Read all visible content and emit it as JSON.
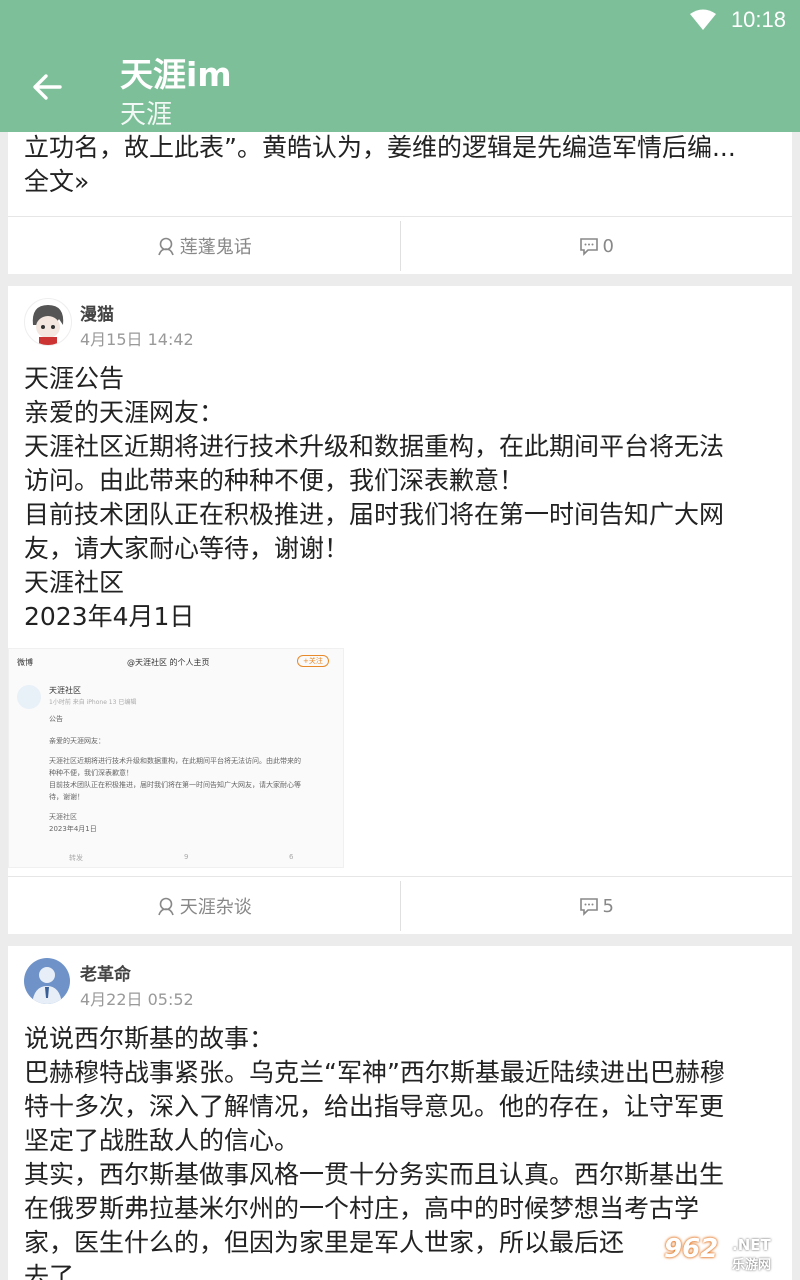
{
  "status_bar": {
    "time": "10:18"
  },
  "app_bar": {
    "title": "天涯im",
    "subtitle": "天涯"
  },
  "card1": {
    "text_lines": [
      "立功名，故上此表”。黄皓认为，姜维的逻辑是先编造军情后编...",
      "全文»"
    ],
    "board": "莲蓬鬼话",
    "comments": "0"
  },
  "card2": {
    "author": "漫猫",
    "time": "4月15日 14:42",
    "text_lines": [
      "天涯公告",
      "亲爱的天涯网友：",
      "天涯社区近期将进行技术升级和数据重构，在此期间平台将无法",
      "访问。由此带来的种种不便，我们深表歉意！",
      "目前技术团队正在积极推进，届时我们将在第一时间告知广大网",
      "友，请大家耐心等待，谢谢！",
      "天涯社区",
      "2023年4月1日"
    ],
    "image": {
      "back": "微博",
      "header": "@天涯社区 的个人主页",
      "follow": "+关注",
      "account": "天涯社区",
      "meta": "1小时前 来自 iPhone 13 已编辑",
      "lines": [
        "公告",
        "亲爱的天涯网友：",
        "天涯社区近期将进行技术升级和数据重构，在此期间平台将无法访问。由此带来的",
        "种种不便，我们深表歉意！",
        "目前技术团队正在积极推进，届时我们将在第一时间告知广大网友，请大家耐心等",
        "待，谢谢！",
        "天涯社区",
        "2023年4月1日"
      ],
      "repost": "转发",
      "comment": "9",
      "like": "6"
    },
    "board": "天涯杂谈",
    "comments": "5"
  },
  "card3": {
    "author": "老革命",
    "time": "4月22日 05:52",
    "text_lines": [
      "说说西尔斯基的故事：",
      "巴赫穆特战事紧张。乌克兰“军神”西尔斯基最近陆续进出巴赫穆",
      "特十多次，深入了解情况，给出指导意见。他的存在，让守军更",
      "坚定了战胜敌人的信心。",
      "其实，西尔斯基做事风格一贯十分务实而且认真。西尔斯基出生",
      "在俄罗斯弗拉基米尔州的一个村庄，高中的时候梦想当考古学",
      "家，医生什么的，但因为家里是军人世家，所以最后还",
      "去了"
    ]
  },
  "watermark": {
    "number": "962",
    "suffix": ".NET",
    "name": "乐游网"
  },
  "colors": {
    "accent": "#7dbf99"
  }
}
